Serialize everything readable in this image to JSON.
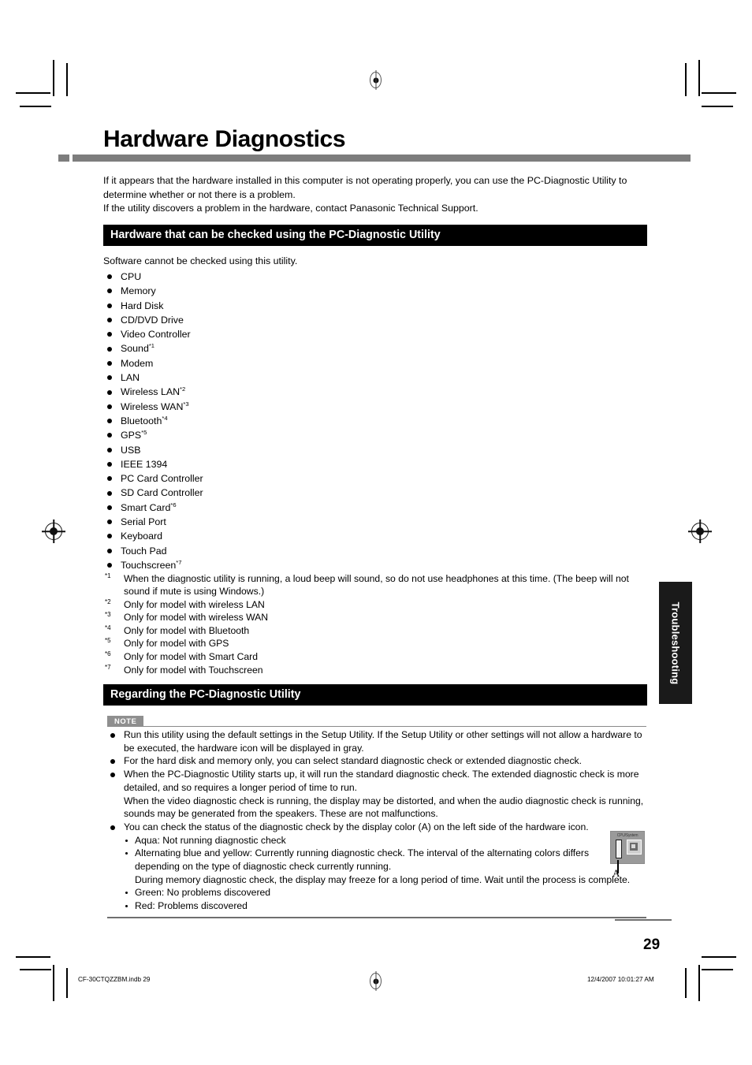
{
  "document": {
    "title": "Hardware Diagnostics",
    "intro": "If it appears that the hardware installed in this computer is not operating properly, you can use the PC-Diagnostic Utility to determine whether or not there is a problem.\nIf the utility discovers a problem in the hardware, contact Panasonic Technical Support.",
    "page_number": "29"
  },
  "section_hardware": {
    "heading": "Hardware that can be checked using the PC-Diagnostic Utility",
    "subnote": "Software cannot be checked using this utility.",
    "items": [
      {
        "label": "CPU",
        "note": ""
      },
      {
        "label": "Memory",
        "note": ""
      },
      {
        "label": "Hard Disk",
        "note": ""
      },
      {
        "label": "CD/DVD Drive",
        "note": ""
      },
      {
        "label": "Video Controller",
        "note": ""
      },
      {
        "label": "Sound",
        "note": "*1"
      },
      {
        "label": "Modem",
        "note": ""
      },
      {
        "label": "LAN",
        "note": ""
      },
      {
        "label": "Wireless LAN",
        "note": "*2"
      },
      {
        "label": "Wireless WAN",
        "note": "*3"
      },
      {
        "label": "Bluetooth",
        "note": "*4"
      },
      {
        "label": "GPS",
        "note": "*5"
      },
      {
        "label": "USB",
        "note": ""
      },
      {
        "label": "IEEE 1394",
        "note": ""
      },
      {
        "label": "PC Card Controller",
        "note": ""
      },
      {
        "label": "SD Card Controller",
        "note": ""
      },
      {
        "label": "Smart Card",
        "note": "*6"
      },
      {
        "label": "Serial Port",
        "note": ""
      },
      {
        "label": "Keyboard",
        "note": ""
      },
      {
        "label": "Touch Pad",
        "note": ""
      },
      {
        "label": "Touchscreen",
        "note": "*7"
      }
    ],
    "footnotes": [
      {
        "mark": "*1",
        "text": "When the diagnostic utility is running, a loud beep will sound, so do not use headphones at this time. (The beep will not sound if mute is using Windows.)"
      },
      {
        "mark": "*2",
        "text": "Only for model with wireless LAN"
      },
      {
        "mark": "*3",
        "text": "Only for model with wireless WAN"
      },
      {
        "mark": "*4",
        "text": "Only for model with Bluetooth"
      },
      {
        "mark": "*5",
        "text": "Only for model with GPS"
      },
      {
        "mark": "*6",
        "text": "Only for model with Smart Card"
      },
      {
        "mark": "*7",
        "text": "Only for model with Touchscreen"
      }
    ]
  },
  "section_regarding": {
    "heading": "Regarding the PC-Diagnostic Utility",
    "note_badge": "NOTE",
    "note_items": [
      "Run this utility using the default settings in the Setup Utility. If the Setup Utility or other settings will not allow a hardware to be executed, the hardware icon will be displayed in gray.",
      "For the hard disk and memory only, you can select standard diagnostic check or extended diagnostic check.",
      "When the PC-Diagnostic Utility starts up, it will run the standard diagnostic check. The extended diagnostic check is more detailed, and so requires a longer period of time to run.",
      "When the video diagnostic check is running, the display may be distorted, and when the audio diagnostic check is running, sounds may be generated from the speakers. These are not malfunctions.",
      "You can check the status of the diagnostic check by the display color (A) on the left side of the hardware icon."
    ],
    "status_colors": [
      "Aqua: Not running diagnostic check",
      "Alternating blue and yellow: Currently running diagnostic check. The interval of the alternating colors differs depending on the type of diagnostic check currently running.",
      "During memory diagnostic check, the display may freeze for a long period of time. Wait until the process is complete.",
      "Green: No problems discovered",
      "Red: Problems discovered"
    ]
  },
  "side_tab": {
    "label": "Troubleshooting"
  },
  "hardware_icon": {
    "caption": "CPU/System",
    "callout": "A"
  },
  "footer": {
    "file": "CF-30CTQZZBM.indb   29",
    "timestamp": "12/4/2007   10:01:27 AM"
  },
  "colors": {
    "heading_bar": "#000000",
    "rule_gray": "#7d7d7d",
    "note_badge": "#8f8f8f",
    "side_tab": "#1a1a1a"
  }
}
